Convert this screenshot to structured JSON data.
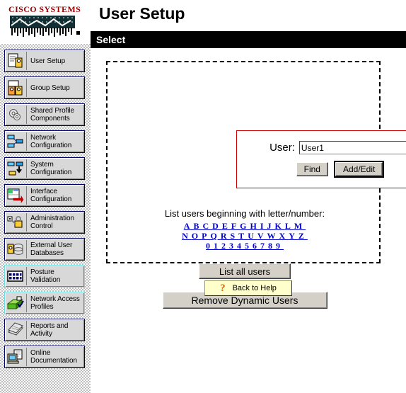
{
  "sidebar": {
    "logo": {
      "brand": "CISCO SYSTEMS",
      "icon": "cisco-bridge-logo"
    },
    "items": [
      {
        "label": "User\nSetup",
        "icon": "user-setup-icon",
        "highlight": false
      },
      {
        "label": "Group\nSetup",
        "icon": "group-setup-icon",
        "highlight": false
      },
      {
        "label": "Shared Profile\nComponents",
        "icon": "shared-profile-icon",
        "highlight": false
      },
      {
        "label": "Network\nConfiguration",
        "icon": "network-config-icon",
        "highlight": false
      },
      {
        "label": "System\nConfiguration",
        "icon": "system-config-icon",
        "highlight": false
      },
      {
        "label": "Interface\nConfiguration",
        "icon": "interface-config-icon",
        "highlight": false
      },
      {
        "label": "Administration\nControl",
        "icon": "administration-control-icon",
        "highlight": false
      },
      {
        "label": "External User\nDatabases",
        "icon": "external-user-db-icon",
        "highlight": false
      },
      {
        "label": "Posture\nValidation",
        "icon": "posture-validation-icon",
        "highlight": true
      },
      {
        "label": "Network Access\nProfiles",
        "icon": "network-access-profiles-icon",
        "highlight": true
      },
      {
        "label": "Reports and\nActivity",
        "icon": "reports-activity-icon",
        "highlight": false
      },
      {
        "label": "Online\nDocumentation",
        "icon": "online-documentation-icon",
        "highlight": false
      }
    ]
  },
  "main": {
    "page_title": "User Setup",
    "section_bar": "Select",
    "form": {
      "user_label": "User:",
      "user_value": "User1",
      "user_placeholder": "",
      "find_label": "Find",
      "add_edit_label": "Add/Edit"
    },
    "list_heading": "List users beginning with letter/number:",
    "alpha_rows": [
      [
        "A",
        "B",
        "C",
        "D",
        "E",
        "F",
        "G",
        "H",
        "I",
        "J",
        "K",
        "L",
        "M"
      ],
      [
        "N",
        "O",
        "P",
        "Q",
        "R",
        "S",
        "T",
        "U",
        "V",
        "W",
        "X",
        "Y",
        "Z"
      ],
      [
        "0",
        "1",
        "2",
        "3",
        "4",
        "5",
        "6",
        "7",
        "8",
        "9"
      ]
    ],
    "list_all_label": "List all users",
    "remove_dynamic_label": "Remove Dynamic Users",
    "back_to_help_label": "Back to Help",
    "help_icon_glyph": "?"
  },
  "colors": {
    "brand_red": "#990000",
    "link_blue": "#0000cc",
    "form_border_red": "#cc0000",
    "bar_black": "#000000",
    "help_yellow": "#ffffcc",
    "help_icon_orange": "#cc6600",
    "nav_border_blue": "#000066",
    "nav_highlight_cyan": "#66e0e0"
  }
}
